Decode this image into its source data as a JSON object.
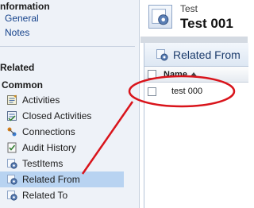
{
  "nav": {
    "information_heading": "nformation",
    "info_links": [
      {
        "label": "General"
      },
      {
        "label": "Notes"
      }
    ],
    "related_heading": "Related",
    "common_heading": "Common",
    "items": [
      {
        "label": "Activities",
        "icon": "activities-icon"
      },
      {
        "label": "Closed Activities",
        "icon": "closed-activities-icon"
      },
      {
        "label": "Connections",
        "icon": "connections-icon"
      },
      {
        "label": "Audit History",
        "icon": "audit-history-icon"
      },
      {
        "label": "TestItems",
        "icon": "entity-gear-icon"
      },
      {
        "label": "Related From",
        "icon": "entity-gear-icon",
        "selected": true
      },
      {
        "label": "Related To",
        "icon": "entity-gear-icon"
      }
    ]
  },
  "record": {
    "type": "Test",
    "name": "Test 001"
  },
  "panel": {
    "title": "Related From",
    "grid": {
      "columns": [
        "Name"
      ],
      "sort": "ascending",
      "rows": [
        {
          "name": "test 000"
        }
      ]
    }
  },
  "colors": {
    "nav_bg": "#eef2f8",
    "selected_bg": "#b8d3f1",
    "link": "#15428b",
    "annotation_red": "#d9141b"
  }
}
